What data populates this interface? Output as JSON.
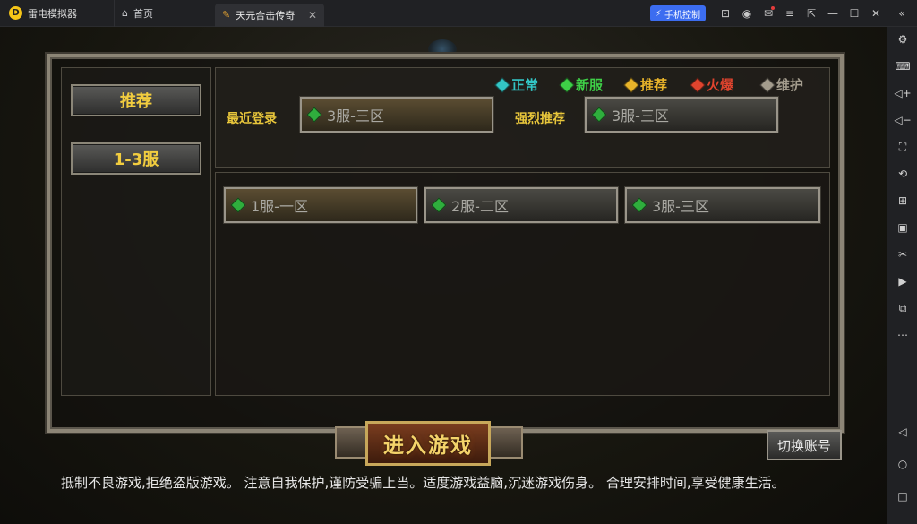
{
  "titlebar": {
    "app_name": "雷电模拟器",
    "home_tab": "首页",
    "game_tab": "天元合击传奇",
    "phone_control": "手机控制",
    "icons": [
      "gamepad-icon",
      "user-icon",
      "mail-icon",
      "menu-icon",
      "window-restore-icon",
      "minimize-icon",
      "maximize-icon",
      "close-icon",
      "collapse-icon"
    ]
  },
  "sidebar": {
    "icons": [
      "settings-icon",
      "keyboard-icon",
      "volume-up-icon",
      "volume-down-icon",
      "screenshot-icon",
      "sync-icon",
      "add-apk-icon",
      "apk-icon",
      "scissors-icon",
      "record-icon",
      "multi-instance-icon",
      "more-icon",
      "back-icon",
      "home-icon",
      "recent-apps-icon"
    ]
  },
  "game": {
    "side_tabs": [
      "推荐",
      "1-3服"
    ],
    "legend": [
      {
        "label": "正常",
        "color": "#33c6c6"
      },
      {
        "label": "新服",
        "color": "#3ecf47"
      },
      {
        "label": "推荐",
        "color": "#e8b42a"
      },
      {
        "label": "火爆",
        "color": "#e0442e"
      },
      {
        "label": "维护",
        "color": "#a39c8d"
      }
    ],
    "recent_label": "最近登录",
    "recent_server": "3服-三区",
    "recommend_label": "强烈推荐",
    "recommend_server": "3服-三区",
    "servers": [
      "1服-一区",
      "2服-二区",
      "3服-三区"
    ],
    "enter_button": "进入游戏",
    "switch_account": "切换账号",
    "notice": "抵制不良游戏,拒绝盗版游戏。 注意自我保护,谨防受骗上当。适度游戏益脑,沉迷游戏伤身。 合理安排时间,享受健康生活。"
  }
}
